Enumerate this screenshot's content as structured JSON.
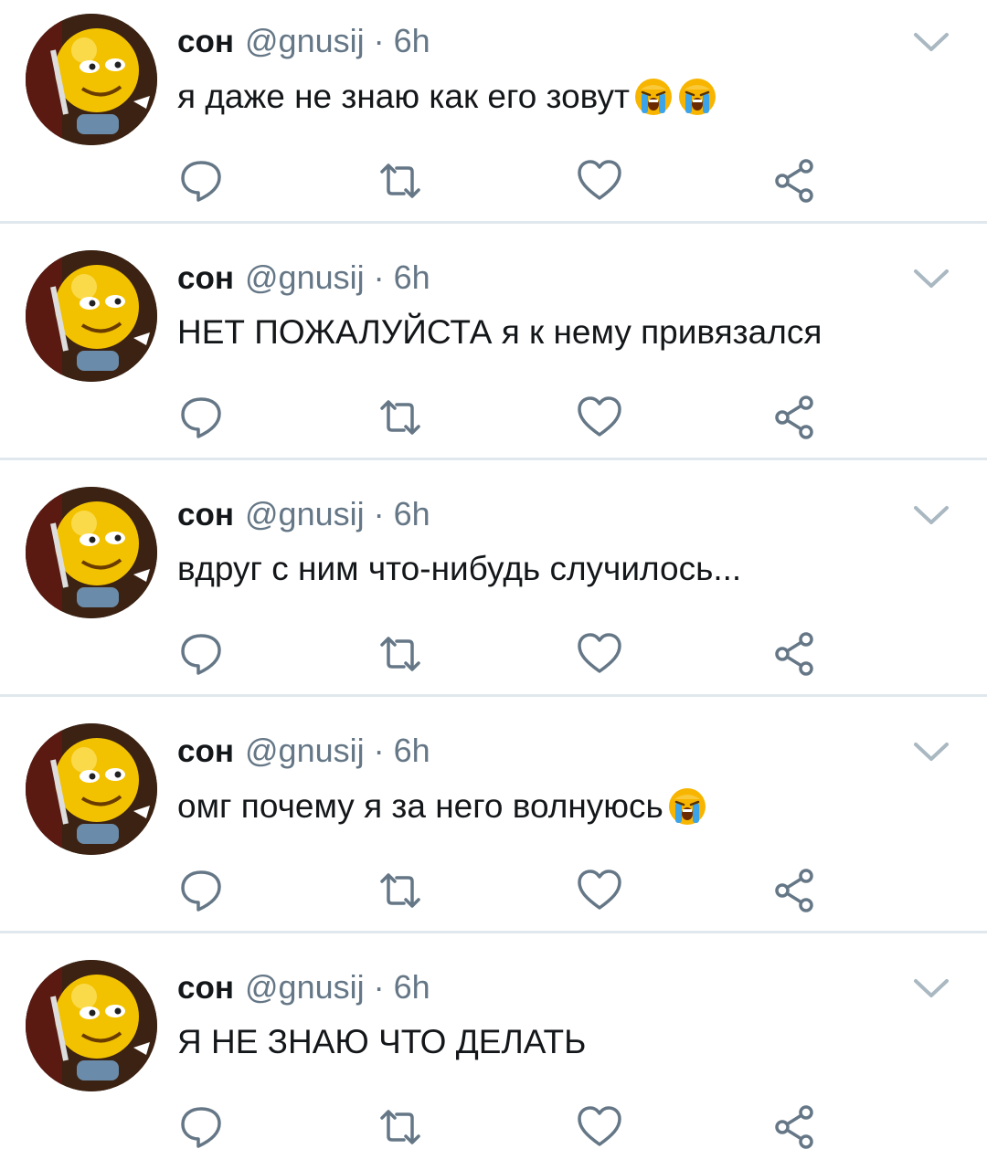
{
  "colors": {
    "text": "#14171a",
    "secondary": "#657786",
    "divider": "#e1e8ed",
    "icon": "#657786"
  },
  "action_icons": [
    "reply-icon",
    "retweet-icon",
    "like-icon",
    "share-icon"
  ],
  "tweets": [
    {
      "author_name": "сон",
      "handle": "@gnusij",
      "separator": "·",
      "time": "6h",
      "text": "я даже не знаю как его зовут",
      "emoji": [
        "loudly-crying-face",
        "loudly-crying-face"
      ]
    },
    {
      "author_name": "сон",
      "handle": "@gnusij",
      "separator": "·",
      "time": "6h",
      "text": "НЕТ ПОЖАЛУЙСТА я к нему привязался",
      "emoji": []
    },
    {
      "author_name": "сон",
      "handle": "@gnusij",
      "separator": "·",
      "time": "6h",
      "text": "вдруг с ним что-нибудь случилось...",
      "emoji": []
    },
    {
      "author_name": "сон",
      "handle": "@gnusij",
      "separator": "·",
      "time": "6h",
      "text": "омг почему я за него волнуюсь ",
      "emoji": [
        "loudly-crying-face"
      ]
    },
    {
      "author_name": "сон",
      "handle": "@gnusij",
      "separator": "·",
      "time": "6h",
      "text": "Я НЕ ЗНАЮ ЧТО ДЕЛАТЬ",
      "emoji": []
    }
  ]
}
